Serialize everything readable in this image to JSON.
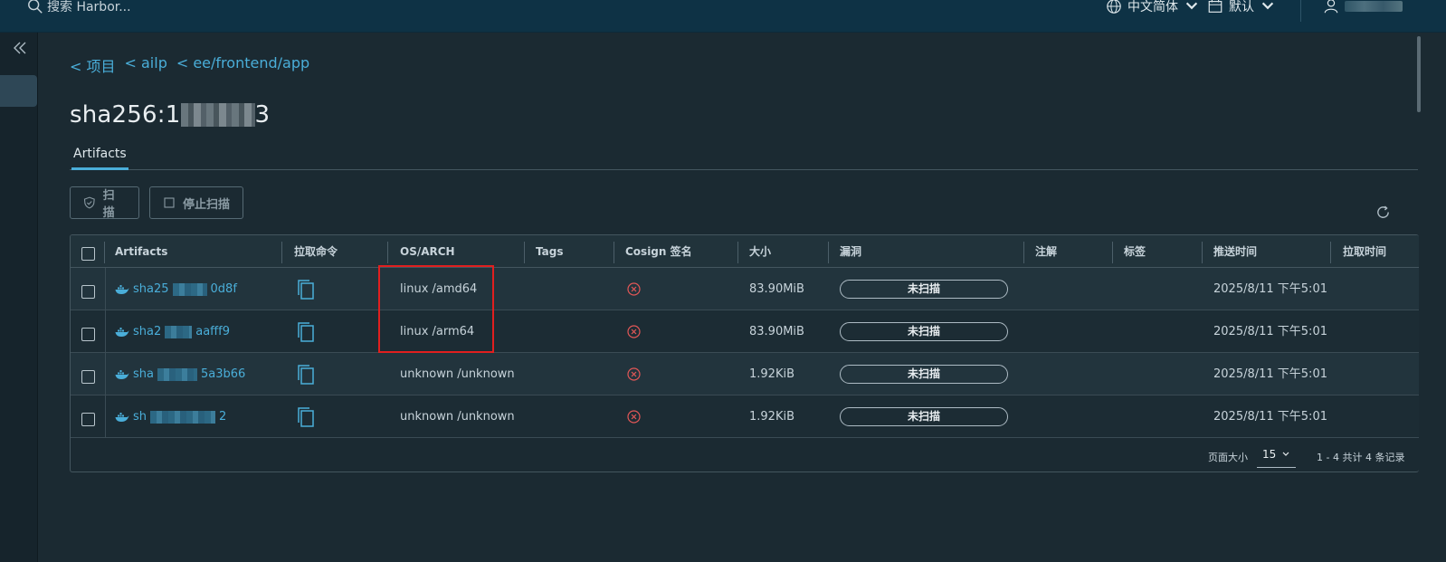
{
  "header": {
    "search_placeholder": "搜索 Harbor...",
    "language": "中文简体",
    "calendar": "默认"
  },
  "breadcrumb": [
    "< 项目",
    "< ailp",
    "< ee/frontend/app"
  ],
  "page_title_prefix": "sha256:1",
  "page_title_suffix": "3",
  "tabs": [
    "Artifacts"
  ],
  "toolbar": {
    "scan_label": "扫描",
    "stop_scan_label": "停止扫描"
  },
  "table": {
    "columns": [
      "Artifacts",
      "拉取命令",
      "OS/ARCH",
      "Tags",
      "Cosign 签名",
      "大小",
      "漏洞",
      "注解",
      "标签",
      "推送时间",
      "拉取时间"
    ],
    "rows": [
      {
        "digest_prefix": "sha25",
        "digest_suffix": "0d8f",
        "os_arch": "linux /amd64",
        "size": "83.90MiB",
        "vuln": "未扫描",
        "push_time": "2025/8/11 下午5:01"
      },
      {
        "digest_prefix": "sha2",
        "digest_suffix": "aafff9",
        "os_arch": "linux /arm64",
        "size": "83.90MiB",
        "vuln": "未扫描",
        "push_time": "2025/8/11 下午5:01"
      },
      {
        "digest_prefix": "sha",
        "digest_suffix": "5a3b66",
        "os_arch": "unknown /unknown",
        "size": "1.92KiB",
        "vuln": "未扫描",
        "push_time": "2025/8/11 下午5:01"
      },
      {
        "digest_prefix": "sh",
        "digest_suffix": "2",
        "os_arch": "unknown /unknown",
        "size": "1.92KiB",
        "vuln": "未扫描",
        "push_time": "2025/8/11 下午5:01"
      }
    ]
  },
  "pagination": {
    "page_size_label": "页面大小",
    "page_size": "15",
    "summary": "1 - 4 共计 4 条记录"
  }
}
